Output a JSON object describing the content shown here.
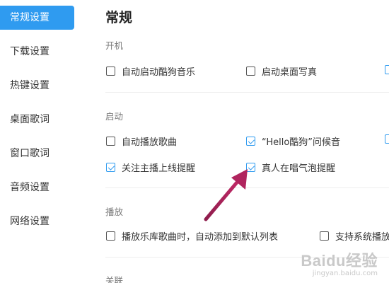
{
  "sidebar": {
    "items": [
      {
        "label": "常规设置",
        "active": true
      },
      {
        "label": "下载设置",
        "active": false
      },
      {
        "label": "热键设置",
        "active": false
      },
      {
        "label": "桌面歌词",
        "active": false
      },
      {
        "label": "窗口歌词",
        "active": false
      },
      {
        "label": "音频设置",
        "active": false
      },
      {
        "label": "网络设置",
        "active": false
      }
    ]
  },
  "main": {
    "title": "常规",
    "sections": {
      "startup": {
        "title": "开机",
        "options": [
          {
            "label": "自动启动酷狗音乐",
            "checked": false
          },
          {
            "label": "启动桌面写真",
            "checked": false
          }
        ]
      },
      "launch": {
        "title": "启动",
        "options": [
          {
            "label": "自动播放歌曲",
            "checked": false
          },
          {
            "label": "“Hello酷狗”问候音",
            "checked": true
          },
          {
            "label": "关注主播上线提醒",
            "checked": true
          },
          {
            "label": "真人在唱气泡提醒",
            "checked": true
          }
        ]
      },
      "playback": {
        "title": "播放",
        "options": [
          {
            "label": "播放乐库歌曲时，自动添加到默认列表",
            "checked": false
          },
          {
            "label": "支持系统播放",
            "checked": false
          }
        ]
      },
      "association": {
        "title": "关联"
      }
    }
  },
  "annotation": {
    "color": "#b0245e"
  },
  "watermark": {
    "logo": "Baidu经验",
    "sub": "jingyan.baidu.com"
  },
  "colors": {
    "accent": "#2f9bf0",
    "text": "#333333",
    "section": "#7a7a7a"
  }
}
